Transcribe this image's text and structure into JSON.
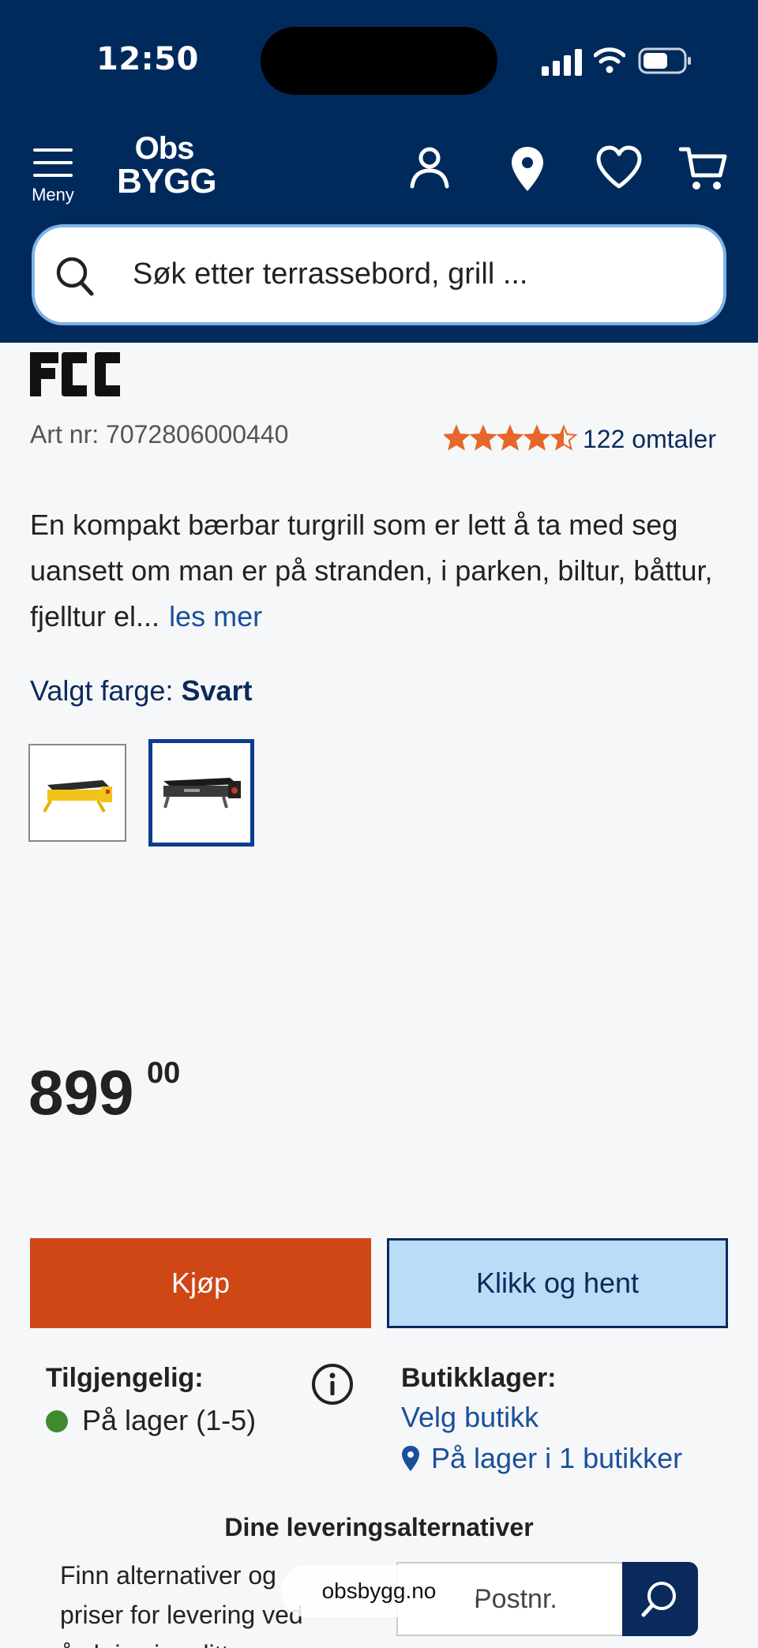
{
  "status_bar": {
    "time": "12:50"
  },
  "header": {
    "menu_label": "Meny",
    "logo_line1": "Obs",
    "logo_line2": "BYGG"
  },
  "search": {
    "placeholder": "Søk etter terrassebord, grill ..."
  },
  "product": {
    "brand": "FCC",
    "art_nr": "Art nr: 7072806000440",
    "rating": 4.5,
    "rating_max": 5,
    "reviews": "122 omtaler",
    "description": "En kompakt bærbar turgrill som er lett å ta med seg uansett om man er på stranden, i parken, biltur, båttur, fjelltur el...",
    "read_more": "les mer",
    "color_label": "Valgt farge: ",
    "color_value": "Svart",
    "price_main": "899",
    "price_cents": "00"
  },
  "actions": {
    "buy": "Kjøp",
    "click_collect": "Klikk og hent"
  },
  "availability": {
    "title": "Tilgjengelig:",
    "status": "På lager (1-5)",
    "status_color": "#3d8b2e"
  },
  "store_stock": {
    "title": "Butikklager:",
    "choose": "Velg butikk",
    "stock": "På lager i 1 butikker"
  },
  "delivery": {
    "title": "Dine leveringsalternativer",
    "text": "Finn alternativer og priser for levering ved å skrive inn ditt postnummer",
    "zip_placeholder": "Postnr."
  },
  "browser": {
    "url": "obsbygg.no"
  },
  "colors": {
    "header_bg": "#002a5c",
    "buy_bg": "#cf4714",
    "click_collect_bg": "#b9ddf6",
    "link": "#1a4f9c",
    "star": "#e5672a"
  }
}
